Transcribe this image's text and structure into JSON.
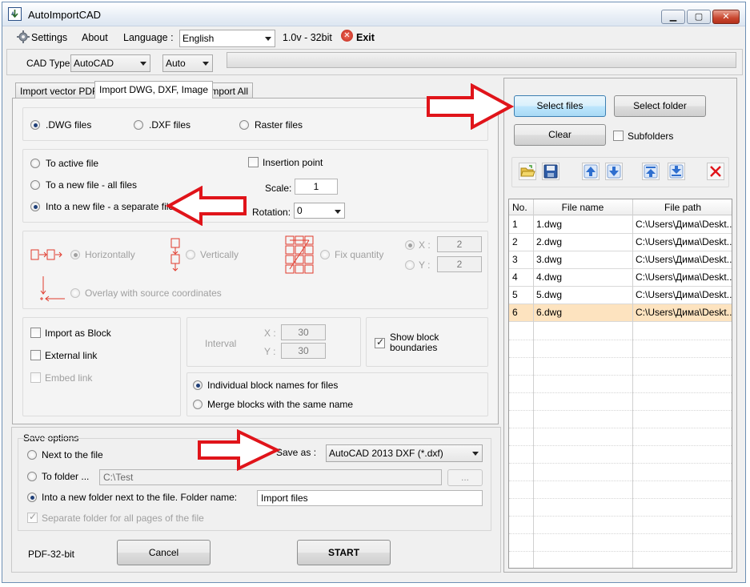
{
  "window": {
    "title": "AutoImportCAD"
  },
  "menu": {
    "settings": "Settings",
    "about": "About",
    "language_label": "Language :",
    "language_value": "English",
    "version": "1.0v - 32bit",
    "exit": "Exit"
  },
  "toolbar": {
    "cad_type_label": "CAD Type:",
    "cad_type_value": "AutoCAD",
    "mode_value": "Auto"
  },
  "tabs": [
    "Import vector PDF",
    "Import DWG, DXF, Image",
    "Import All"
  ],
  "file_type": {
    "options": [
      ".DWG files",
      ".DXF files",
      "Raster files"
    ],
    "selected": ".DWG files"
  },
  "target": {
    "options": [
      "To active file",
      "To a new file - all files",
      "Into a new file - a separate file"
    ],
    "selected": "Into a new file - a separate file",
    "insertion_point_label": "Insertion point",
    "scale_label": "Scale:",
    "scale_value": "1",
    "rotation_label": "Rotation:",
    "rotation_value": "0"
  },
  "layout": {
    "horizontally": "Horizontally",
    "vertically": "Vertically",
    "fix_quantity": "Fix quantity",
    "overlay": "Overlay with source coordinates",
    "x_label": "X :",
    "y_label": "Y :",
    "x_value": "2",
    "y_value": "2"
  },
  "block": {
    "import_as_block": "Import as Block",
    "external_link": "External link",
    "embed_link": "Embed link",
    "interval_label": "Interval",
    "interval_x_label": "X :",
    "interval_y_label": "Y :",
    "interval_x": "30",
    "interval_y": "30",
    "show_block_boundaries": "Show block boundaries",
    "show_block_boundaries_checked": true,
    "names_options": [
      "Individual block names for files",
      "Merge blocks with the same name"
    ],
    "names_selected": "Individual block names for files"
  },
  "save_options": {
    "title": "Save options",
    "next_to_file": "Next to the file",
    "to_folder": "To folder ...",
    "folder_path": "C:\\Test",
    "browse": "...",
    "into_new_folder": "Into a new folder next to the file. Folder name:",
    "folder_name": "Import files",
    "separate_folder": "Separate folder for all pages of the file",
    "save_as_label": "Save as :",
    "save_as_value": "AutoCAD 2013 DXF (*.dxf)"
  },
  "footer": {
    "build_label": "PDF-32-bit",
    "cancel": "Cancel",
    "start": "START"
  },
  "right": {
    "select_files": "Select files",
    "select_folder": "Select folder",
    "clear": "Clear",
    "subfolders": "Subfolders",
    "columns": [
      "No.",
      "File name",
      "File path"
    ],
    "rows": [
      {
        "no": "1",
        "name": "1.dwg",
        "path": "C:\\Users\\Дима\\Deskt..."
      },
      {
        "no": "2",
        "name": "2.dwg",
        "path": "C:\\Users\\Дима\\Deskt..."
      },
      {
        "no": "3",
        "name": "3.dwg",
        "path": "C:\\Users\\Дима\\Deskt..."
      },
      {
        "no": "4",
        "name": "4.dwg",
        "path": "C:\\Users\\Дима\\Deskt..."
      },
      {
        "no": "5",
        "name": "5.dwg",
        "path": "C:\\Users\\Дима\\Deskt..."
      },
      {
        "no": "6",
        "name": "6.dwg",
        "path": "C:\\Users\\Дима\\Deskt..."
      }
    ],
    "selected_row": "6"
  },
  "colors": {
    "annotation_red": "#e0141a",
    "selected_row": "#fde3bf",
    "icon_blue": "#2f6fcf"
  }
}
